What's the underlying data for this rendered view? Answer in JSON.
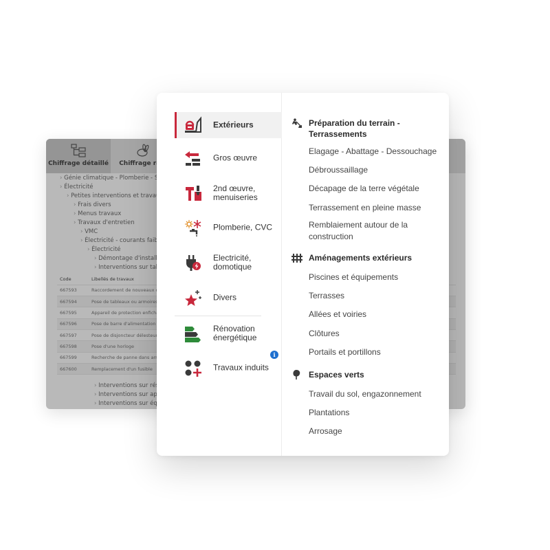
{
  "background_window": {
    "tabs": [
      {
        "label": "Chiffrage détaillé",
        "icon": "tree-diagram-icon"
      },
      {
        "label": "Chiffrage rapi",
        "icon": "rabbit-icon"
      }
    ],
    "tree": [
      "Génie climatique - Plomberie - San",
      "Électricité",
      "Petites interventions et travaux p",
      "Frais divers",
      "Menus travaux",
      "Travaux d'entretien",
      "VMC",
      "Électricité - courants faible",
      "Électricité",
      "Démontage d'installat",
      "Interventions sur table"
    ],
    "table": {
      "headers": [
        "Code",
        "Libellés de travaux"
      ],
      "rows": [
        [
          "667593",
          "Raccordement de nouveaux ci"
        ],
        [
          "667594",
          "Pose de tableaux ou armoires"
        ],
        [
          "667595",
          "Appareil de protection enficha"
        ],
        [
          "667596",
          "Pose de barre d'alimentation"
        ],
        [
          "667597",
          "Pose de disjoncteur délesteur"
        ],
        [
          "667598",
          "Pose d'une horloge"
        ],
        [
          "667599",
          "Recherche de panne dans arm"
        ],
        [
          "667600",
          "Remplacement d'un fusible"
        ]
      ]
    },
    "tree_after": [
      "Interventions sur rése",
      "Interventions sur appa",
      "Interventions sur équi"
    ]
  },
  "menu": {
    "categories": [
      {
        "label": "Extérieurs",
        "icon": "exterior-icon",
        "active": true
      },
      {
        "label": "Gros œuvre",
        "icon": "bricks-icon",
        "active": false
      },
      {
        "label": "2nd œuvre, menuiseries",
        "icon": "tools-icon",
        "active": false
      },
      {
        "label": "Plomberie, CVC",
        "icon": "plumbing-icon",
        "active": false
      },
      {
        "label": "Electricité, domotique",
        "icon": "plug-icon",
        "active": false
      },
      {
        "label": "Divers",
        "icon": "stars-icon",
        "active": false
      },
      {
        "label": "Rénovation énergétique",
        "icon": "energy-label-icon",
        "active": false
      },
      {
        "label": "Travaux induits",
        "icon": "dots-plus-icon",
        "active": false,
        "badge": "i"
      }
    ],
    "sections": [
      {
        "title": "Préparation du terrain - Terrassements",
        "icon": "digging-icon",
        "items": [
          "Elagage - Abattage - Dessouchage",
          "Débroussaillage",
          "Décapage de la terre végétale",
          "Terrassement en pleine masse",
          "Remblaiement autour de la construction"
        ]
      },
      {
        "title": "Aménagements extérieurs",
        "icon": "fence-icon",
        "items": [
          "Piscines et équipements",
          "Terrasses",
          "Allées et voiries",
          "Clôtures",
          "Portails et portillons"
        ]
      },
      {
        "title": "Espaces verts",
        "icon": "tree-icon",
        "items": [
          "Travail du sol, engazonnement",
          "Plantations",
          "Arrosage"
        ]
      }
    ]
  },
  "colors": {
    "accent_red": "#c8283c",
    "accent_green": "#2e8b3a",
    "dark_grey": "#3a3a3a",
    "info_blue": "#1d6fcf"
  }
}
